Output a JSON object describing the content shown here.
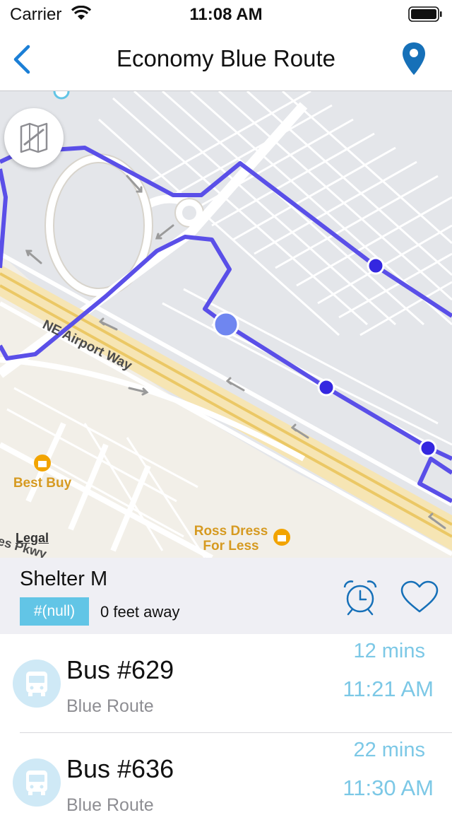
{
  "status_bar": {
    "carrier": "Carrier",
    "time": "11:08 AM"
  },
  "nav": {
    "title": "Economy Blue Route",
    "back_icon": "chevron-left-icon",
    "location_icon": "map-pin-icon"
  },
  "map": {
    "labels": {
      "road": "NE Airport Way",
      "poi_1": "Best Buy",
      "poi_2": "Ross Dress\nFor Less",
      "legal": "Legal",
      "road_fragment": "es Pkwy"
    },
    "route_color": "#5a4fe8",
    "stop_color": "#3427e0",
    "current_stop_color": "#6f86f0"
  },
  "stop": {
    "name": "Shelter M",
    "badge": "#(null)",
    "distance": "0 feet away",
    "alarm_icon": "alarm-clock-icon",
    "favorite_icon": "heart-icon"
  },
  "buses": [
    {
      "name": "Bus #629",
      "route": "Blue Route",
      "eta": "12 mins",
      "time": "11:21 AM"
    },
    {
      "name": "Bus #636",
      "route": "Blue Route",
      "eta": "22 mins",
      "time": "11:30 AM"
    }
  ],
  "colors": {
    "accent": "#1b7fd6",
    "eta": "#7cc8e6",
    "badge": "#62c5e6"
  }
}
